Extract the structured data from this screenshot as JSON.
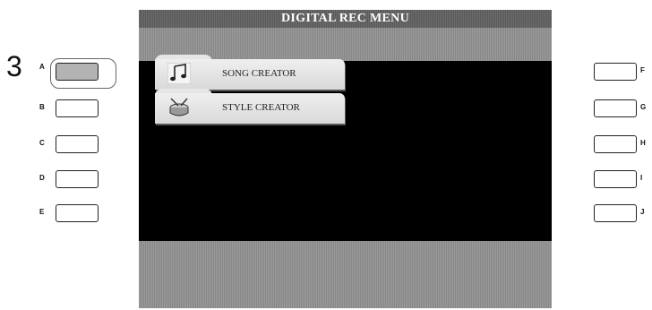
{
  "step_number": "3",
  "screen": {
    "title": "DIGITAL REC MENU",
    "menu_items": [
      {
        "label": "SONG CREATOR",
        "icon": "music-note-icon"
      },
      {
        "label": "STYLE CREATOR",
        "icon": "drum-icon"
      }
    ]
  },
  "left_buttons": [
    "A",
    "B",
    "C",
    "D",
    "E"
  ],
  "right_buttons": [
    "F",
    "G",
    "H",
    "I",
    "J"
  ],
  "pressed_button": "A"
}
